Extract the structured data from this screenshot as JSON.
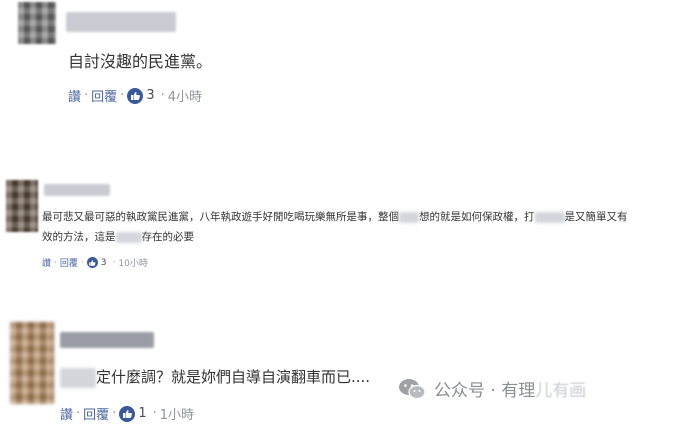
{
  "comments": [
    {
      "text": "自討沒趣的民進黨。",
      "reply_label": "讚",
      "comment_label": "回覆",
      "likes": "3",
      "time": "4小時"
    },
    {
      "text_line1_a": "最可悲又最可惡的執政黨民進黨，八年執政遊手好閒吃喝玩樂無所是事，整個",
      "text_line1_b": "想的就是如何保政權，打",
      "text_line1_c": "是又簡單又有",
      "text_line2_a": "效的方法，這是",
      "text_line2_b": "存在的必要",
      "reply_label": "讚",
      "comment_label": "回覆",
      "likes": "3",
      "time": "10小時"
    },
    {
      "text": "定什麼調？就是妳們自導自演翻車而已....",
      "reply_label": "讚",
      "comment_label": "回覆",
      "likes": "1",
      "time": "1小時"
    }
  ],
  "watermark": {
    "icon": "wechat-icon",
    "label": "公众号 · 有理",
    "faded": "儿有画"
  },
  "colors": {
    "link": "#4b67a1",
    "like_badge": "#3b5998",
    "meta_gray": "#90949c"
  }
}
